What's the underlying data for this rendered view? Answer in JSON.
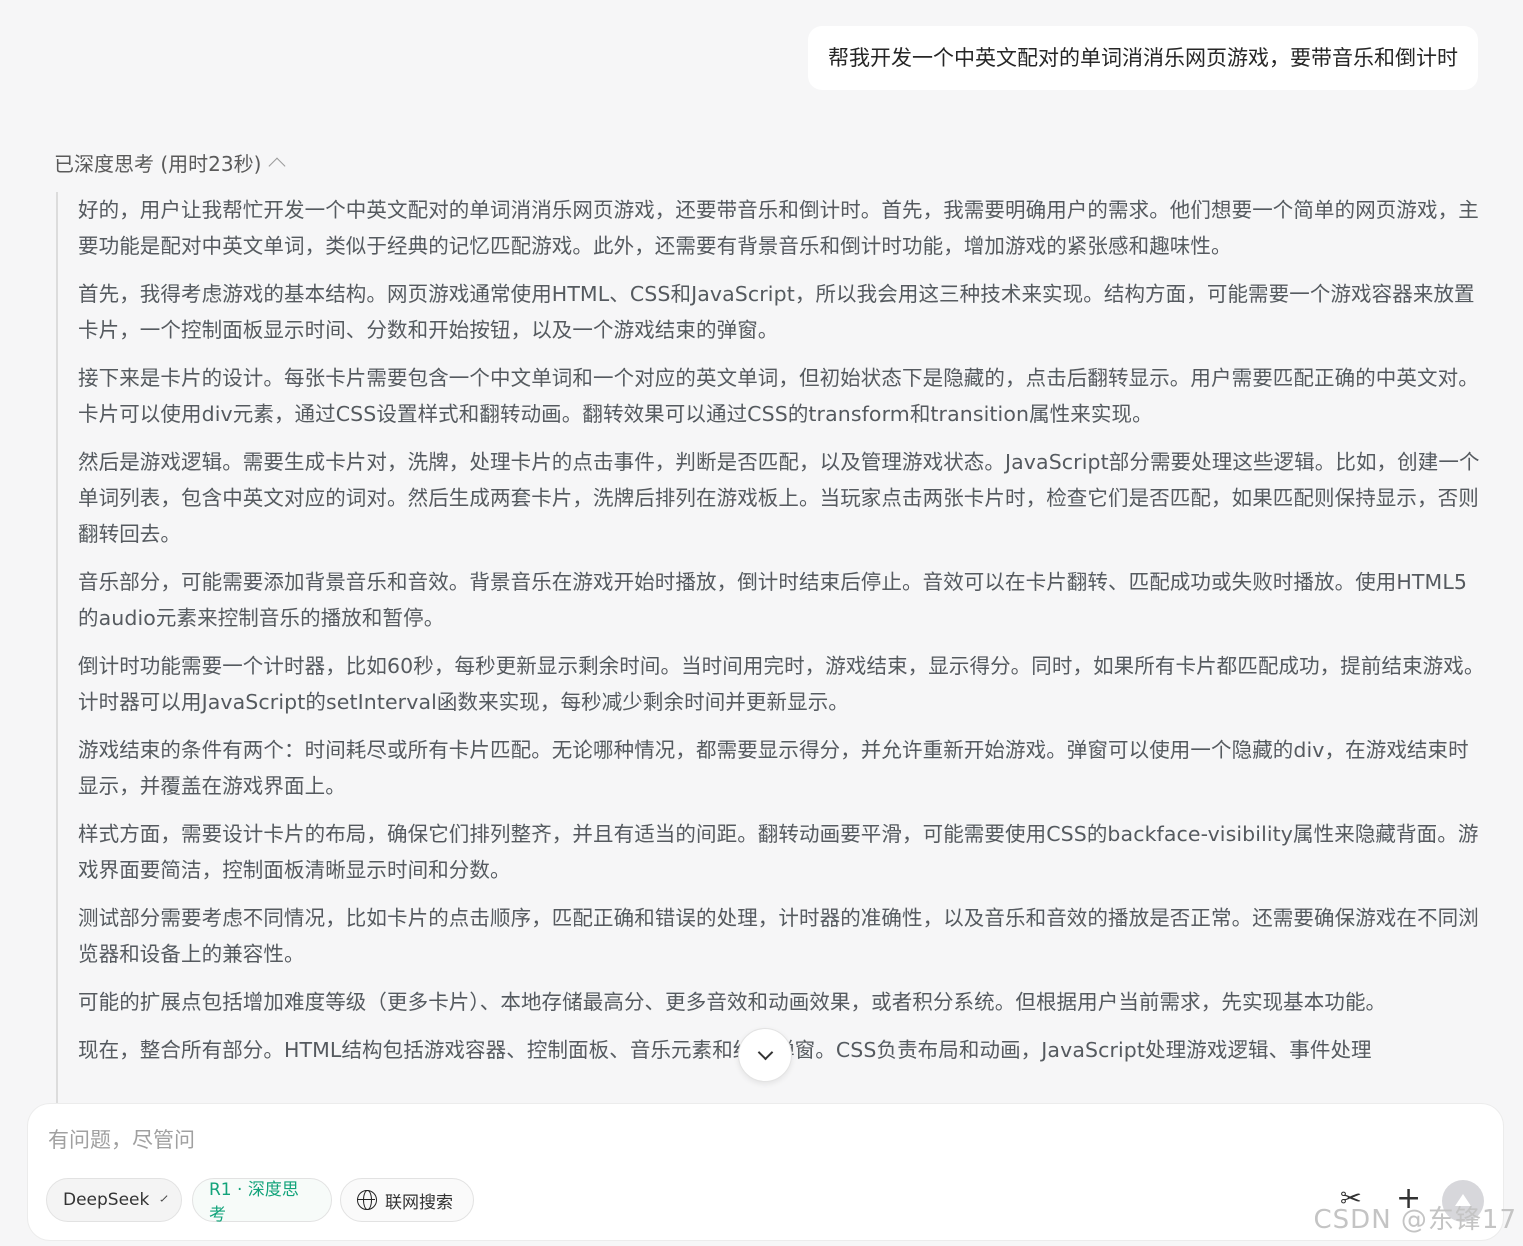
{
  "user_message": "帮我开发一个中英文配对的单词消消乐网页游戏，要带音乐和倒计时",
  "thinking": {
    "header": "已深度思考 (用时23秒)",
    "paragraphs": [
      "好的，用户让我帮忙开发一个中英文配对的单词消消乐网页游戏，还要带音乐和倒计时。首先，我需要明确用户的需求。他们想要一个简单的网页游戏，主要功能是配对中英文单词，类似于经典的记忆匹配游戏。此外，还需要有背景音乐和倒计时功能，增加游戏的紧张感和趣味性。",
      "首先，我得考虑游戏的基本结构。网页游戏通常使用HTML、CSS和JavaScript，所以我会用这三种技术来实现。结构方面，可能需要一个游戏容器来放置卡片，一个控制面板显示时间、分数和开始按钮，以及一个游戏结束的弹窗。",
      "接下来是卡片的设计。每张卡片需要包含一个中文单词和一个对应的英文单词，但初始状态下是隐藏的，点击后翻转显示。用户需要匹配正确的中英文对。卡片可以使用div元素，通过CSS设置样式和翻转动画。翻转效果可以通过CSS的transform和transition属性来实现。",
      "然后是游戏逻辑。需要生成卡片对，洗牌，处理卡片的点击事件，判断是否匹配，以及管理游戏状态。JavaScript部分需要处理这些逻辑。比如，创建一个单词列表，包含中英文对应的词对。然后生成两套卡片，洗牌后排列在游戏板上。当玩家点击两张卡片时，检查它们是否匹配，如果匹配则保持显示，否则翻转回去。",
      "音乐部分，可能需要添加背景音乐和音效。背景音乐在游戏开始时播放，倒计时结束后停止。音效可以在卡片翻转、匹配成功或失败时播放。使用HTML5的audio元素来控制音乐的播放和暂停。",
      "倒计时功能需要一个计时器，比如60秒，每秒更新显示剩余时间。当时间用完时，游戏结束，显示得分。同时，如果所有卡片都匹配成功，提前结束游戏。计时器可以用JavaScript的setInterval函数来实现，每秒减少剩余时间并更新显示。",
      "游戏结束的条件有两个：时间耗尽或所有卡片匹配。无论哪种情况，都需要显示得分，并允许重新开始游戏。弹窗可以使用一个隐藏的div，在游戏结束时显示，并覆盖在游戏界面上。",
      "样式方面，需要设计卡片的布局，确保它们排列整齐，并且有适当的间距。翻转动画要平滑，可能需要使用CSS的backface-visibility属性来隐藏背面。游戏界面要简洁，控制面板清晰显示时间和分数。",
      "测试部分需要考虑不同情况，比如卡片的点击顺序，匹配正确和错误的处理，计时器的准确性，以及音乐和音效的播放是否正常。还需要确保游戏在不同浏览器和设备上的兼容性。",
      "可能的扩展点包括增加难度等级（更多卡片）、本地存储最高分、更多音效和动画效果，或者积分系统。但根据用户当前需求，先实现基本功能。",
      "现在，整合所有部分。HTML结构包括游戏容器、控制面板、音乐元素和结束弹窗。CSS负责布局和动画，JavaScript处理游戏逻辑、事件处理"
    ]
  },
  "composer": {
    "placeholder": "有问题，尽管问",
    "model_label": "DeepSeek",
    "r1_label": "R1 · 深度思考",
    "web_label": "联网搜索"
  },
  "icons": {
    "scissors": "scissors-icon",
    "plus": "plus-icon",
    "send": "send-icon",
    "globe": "globe-icon"
  },
  "watermark": "CSDN @东锋17"
}
